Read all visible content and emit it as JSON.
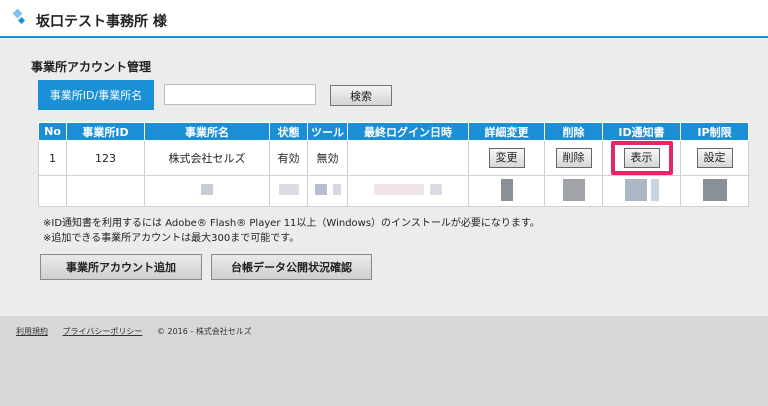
{
  "header": {
    "company_name": "坂口テスト事務所 様"
  },
  "section": {
    "title": "事業所アカウント管理"
  },
  "search": {
    "label": "事業所ID/事業所名",
    "value": "",
    "placeholder": "",
    "button_label": "検索"
  },
  "table": {
    "columns": [
      "No",
      "事業所ID",
      "事業所名",
      "状態",
      "ツール",
      "最終ログイン日時",
      "詳細変更",
      "削除",
      "ID通知書",
      "IP制限"
    ],
    "rows": [
      {
        "no": "1",
        "office_id": "123",
        "office_name": "株式会社セルズ",
        "status": "有効",
        "tool": "無効",
        "last_login": "",
        "detail_button": "変更",
        "delete_button": "削除",
        "id_notice_button": "表示",
        "ip_button": "設定"
      }
    ],
    "highlight_color": "#e8246a"
  },
  "notes": [
    "※ID通知書を利用するには Adobe® Flash® Player 11以上（Windows）のインストールが必要になります。",
    "※追加できる事業所アカウントは最大300まで可能です。"
  ],
  "actions": {
    "add_account": "事業所アカウント追加",
    "ledger_check": "台帳データ公開状況確認"
  },
  "footer": {
    "terms": "利用規約",
    "privacy": "プライバシーポリシー",
    "copyright": "© 2016 - 株式会社セルズ"
  },
  "colors": {
    "accent": "#1a8fd6",
    "highlight": "#e8246a"
  }
}
